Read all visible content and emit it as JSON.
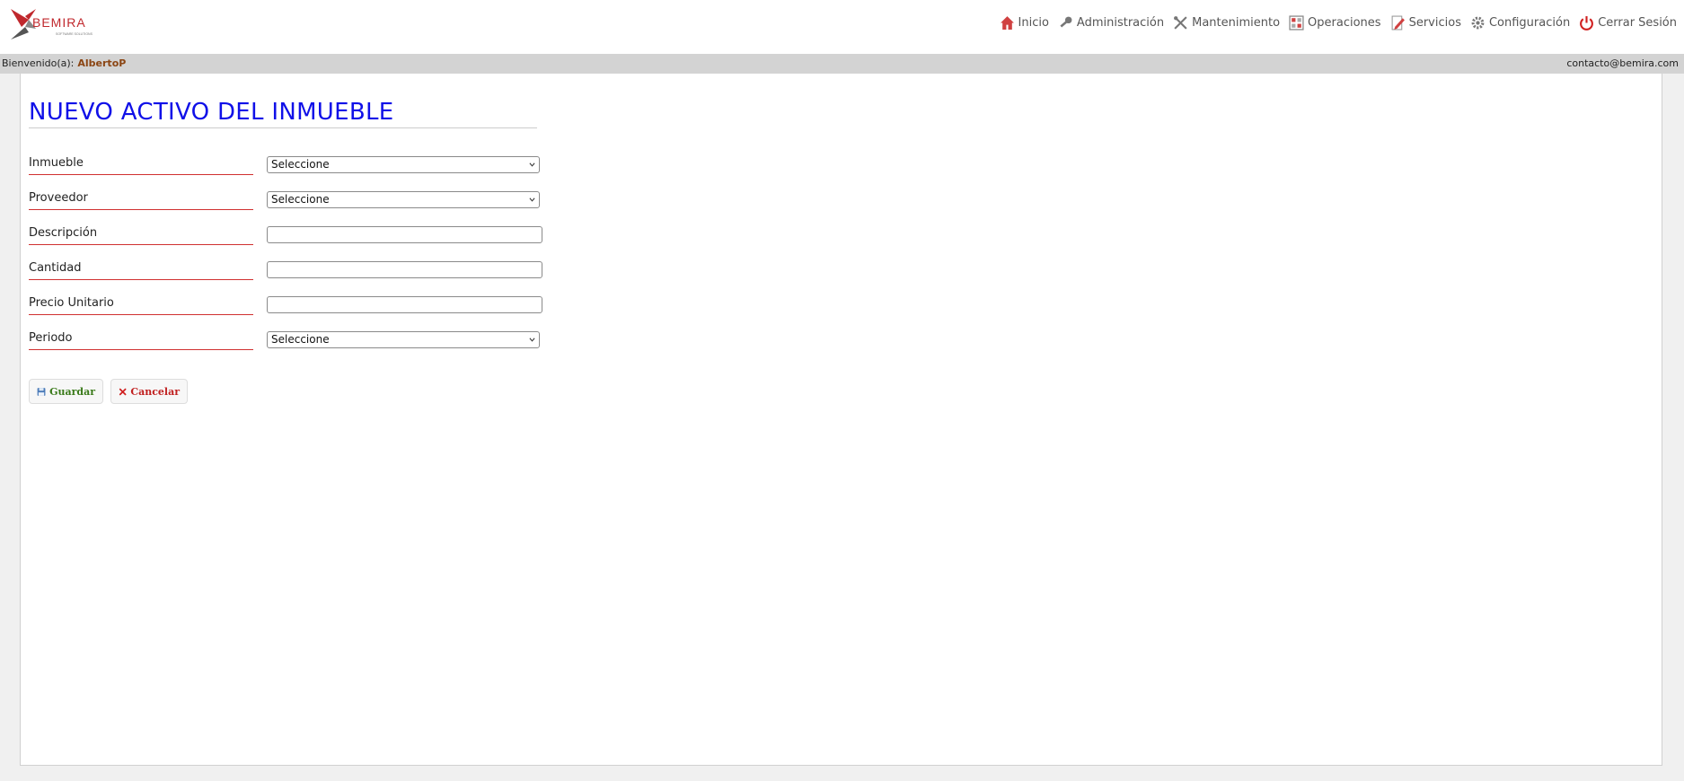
{
  "header": {
    "logo_text": "BEMIRA",
    "logo_subtext": "SOFTWARE SOLUTIONS",
    "nav": [
      {
        "label": "Inicio",
        "icon": "home-icon"
      },
      {
        "label": "Administración",
        "icon": "key-icon"
      },
      {
        "label": "Mantenimiento",
        "icon": "tools-icon"
      },
      {
        "label": "Operaciones",
        "icon": "grid-icon"
      },
      {
        "label": "Servicios",
        "icon": "document-edit-icon"
      },
      {
        "label": "Configuración",
        "icon": "gear-icon"
      },
      {
        "label": "Cerrar Sesión",
        "icon": "power-icon"
      }
    ]
  },
  "welcome": {
    "prefix": "Bienvenido(a):",
    "user": "AlbertoP",
    "contact": "contacto@bemira.com"
  },
  "form": {
    "title": "NUEVO ACTIVO DEL INMUEBLE",
    "fields": [
      {
        "label": "Inmueble",
        "type": "select",
        "value": "Seleccione"
      },
      {
        "label": "Proveedor",
        "type": "select",
        "value": "Seleccione"
      },
      {
        "label": "Descripción",
        "type": "input",
        "value": ""
      },
      {
        "label": "Cantidad",
        "type": "input",
        "value": ""
      },
      {
        "label": "Precio Unitario",
        "type": "input",
        "value": ""
      },
      {
        "label": "Periodo",
        "type": "select",
        "value": "Seleccione"
      }
    ],
    "save_label": "Guardar",
    "cancel_label": "Cancelar"
  },
  "colors": {
    "title": "#1010e8",
    "label_underline": "#d03030",
    "welcome_user": "#8b4513",
    "save_text": "#3a7a1a",
    "cancel_text": "#c02020",
    "brand_red": "#c0282d"
  }
}
